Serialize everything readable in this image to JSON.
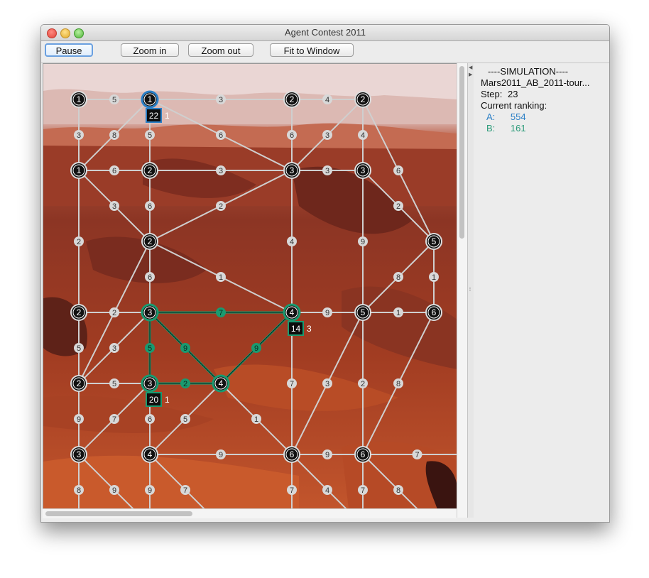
{
  "window": {
    "title": "Agent Contest 2011"
  },
  "toolbar": {
    "pause": "Pause",
    "zoom_in": "Zoom in",
    "zoom_out": "Zoom out",
    "fit": "Fit to Window"
  },
  "sidebar": {
    "header": "----SIMULATION----",
    "simulation_name": "Mars2011_AB_2011-tour...",
    "step_label": "Step:",
    "step": "23",
    "ranking_label": "Current ranking:",
    "teams": [
      {
        "name": "A:",
        "score": "554",
        "color": "#2a7fc6"
      },
      {
        "name": "B:",
        "score": "161",
        "color": "#2a9a78"
      }
    ]
  },
  "map": {
    "colors": {
      "team_a": "#2a7fc6",
      "team_b": "#1a9a70",
      "edge": "#cfcfcf",
      "node": "#111111"
    },
    "nodes": [
      {
        "id": "n00",
        "value": "1"
      },
      {
        "id": "n01",
        "value": "1",
        "team": "A"
      },
      {
        "id": "n03",
        "value": "2"
      },
      {
        "id": "n04",
        "value": "2"
      },
      {
        "id": "n10",
        "value": "1"
      },
      {
        "id": "n11",
        "value": "2"
      },
      {
        "id": "n13",
        "value": "3"
      },
      {
        "id": "n14",
        "value": "3"
      },
      {
        "id": "n21",
        "value": "2"
      },
      {
        "id": "n25",
        "value": "5"
      },
      {
        "id": "n30",
        "value": "2"
      },
      {
        "id": "n31",
        "value": "3",
        "team": "B"
      },
      {
        "id": "n33",
        "value": "4",
        "team": "B"
      },
      {
        "id": "n34",
        "value": "5"
      },
      {
        "id": "n35",
        "value": "6"
      },
      {
        "id": "n40",
        "value": "2"
      },
      {
        "id": "n41",
        "value": "3",
        "team": "B"
      },
      {
        "id": "n42",
        "value": "4",
        "team": "B"
      },
      {
        "id": "n50",
        "value": "3"
      },
      {
        "id": "n51",
        "value": "4"
      },
      {
        "id": "n53",
        "value": "6"
      },
      {
        "id": "n54",
        "value": "6"
      }
    ],
    "edges": [
      {
        "a": "n00",
        "b": "n01",
        "w": "5"
      },
      {
        "a": "n01",
        "b": "n03",
        "w": "3"
      },
      {
        "a": "n03",
        "b": "n04",
        "w": "4"
      },
      {
        "a": "n00",
        "b": "n10",
        "w": "3"
      },
      {
        "a": "n01",
        "b": "n10",
        "w": "8"
      },
      {
        "a": "n01",
        "b": "n11",
        "w": "5"
      },
      {
        "a": "n01",
        "b": "n13",
        "w": "6"
      },
      {
        "a": "n03",
        "b": "n13",
        "w": "6"
      },
      {
        "a": "n04",
        "b": "n13",
        "w": "3"
      },
      {
        "a": "n04",
        "b": "n14",
        "w": "4"
      },
      {
        "a": "n10",
        "b": "n11",
        "w": "6"
      },
      {
        "a": "n11",
        "b": "n13",
        "w": "3"
      },
      {
        "a": "n13",
        "b": "n14",
        "w": "3"
      },
      {
        "a": "n14",
        "b": "n25",
        "w": "2"
      },
      {
        "a": "n10",
        "b": "n21",
        "w": "3"
      },
      {
        "a": "n11",
        "b": "n21",
        "w": "6"
      },
      {
        "a": "n13",
        "b": "n21",
        "w": "2"
      },
      {
        "a": "n04",
        "b": "n25",
        "w": "6"
      },
      {
        "a": "n10",
        "b": "n30",
        "w": "2"
      },
      {
        "a": "n21",
        "b": "n31",
        "w": "6"
      },
      {
        "a": "n21",
        "b": "n33",
        "w": "1"
      },
      {
        "a": "n21",
        "b": "n40",
        "w": "8"
      },
      {
        "a": "n13",
        "b": "n33",
        "w": "4"
      },
      {
        "a": "n14",
        "b": "n34",
        "w": "9"
      },
      {
        "a": "n25",
        "b": "n34",
        "w": "8"
      },
      {
        "a": "n25",
        "b": "n35",
        "w": "1"
      },
      {
        "a": "n30",
        "b": "n31",
        "w": "2"
      },
      {
        "a": "n31",
        "b": "n33",
        "w": "7",
        "team": "B"
      },
      {
        "a": "n33",
        "b": "n34",
        "w": "9"
      },
      {
        "a": "n34",
        "b": "n35",
        "w": "1"
      },
      {
        "a": "n30",
        "b": "n40",
        "w": "5"
      },
      {
        "a": "n31",
        "b": "n40",
        "w": "3"
      },
      {
        "a": "n31",
        "b": "n41",
        "w": "5",
        "team": "B"
      },
      {
        "a": "n31",
        "b": "n42",
        "w": "9",
        "team": "B"
      },
      {
        "a": "n33",
        "b": "n42",
        "w": "9",
        "team": "B"
      },
      {
        "a": "n33",
        "b": "n53",
        "w": "7"
      },
      {
        "a": "n34",
        "b": "n53",
        "w": "3"
      },
      {
        "a": "n34",
        "b": "n54",
        "w": "2"
      },
      {
        "a": "n35",
        "b": "n54",
        "w": "8"
      },
      {
        "a": "n40",
        "b": "n41",
        "w": "5"
      },
      {
        "a": "n41",
        "b": "n42",
        "w": "2",
        "team": "B"
      },
      {
        "a": "n40",
        "b": "n50",
        "w": "9"
      },
      {
        "a": "n41",
        "b": "n50",
        "w": "7"
      },
      {
        "a": "n41",
        "b": "n51",
        "w": "6"
      },
      {
        "a": "n42",
        "b": "n51",
        "w": "5"
      },
      {
        "a": "n42",
        "b": "n53",
        "w": "1"
      },
      {
        "a": "n51",
        "b": "n53",
        "w": "9"
      },
      {
        "a": "n53",
        "b": "n54",
        "w": "9"
      },
      {
        "a": "n54",
        "b": "n5e",
        "w": "7"
      }
    ],
    "extra_weights": [
      {
        "pos": "n50_down",
        "w": "8"
      },
      {
        "pos": "n50_dr",
        "w": "9"
      },
      {
        "pos": "n51_down",
        "w": "9"
      },
      {
        "pos": "n51_dr",
        "w": "7"
      },
      {
        "pos": "n53_down",
        "w": "7"
      },
      {
        "pos": "n53_dr",
        "w": "4"
      },
      {
        "pos": "n54_down",
        "w": "7"
      },
      {
        "pos": "n54_dr",
        "w": "8"
      }
    ],
    "agents": [
      {
        "id": "agent-a1",
        "label": "22",
        "extra": "1",
        "team": "A",
        "near": "n01"
      },
      {
        "id": "agent-b1",
        "label": "14",
        "extra": "3",
        "team": "B",
        "near": "n33"
      },
      {
        "id": "agent-b2",
        "label": "20",
        "extra": "1",
        "team": "B",
        "near": "n41"
      }
    ]
  }
}
